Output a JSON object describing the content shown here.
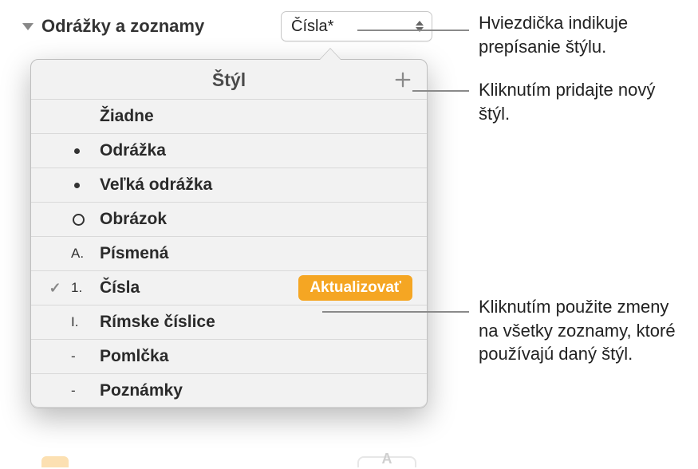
{
  "header": {
    "title": "Odrážky a zoznamy",
    "selected_style": "Čísla*"
  },
  "popover": {
    "title": "Štýl",
    "add_icon": "plus-icon",
    "items": [
      {
        "marker_type": "none",
        "marker": "",
        "label": "Žiadne",
        "selected": false
      },
      {
        "marker_type": "dot",
        "marker": "",
        "label": "Odrážka",
        "selected": false
      },
      {
        "marker_type": "dot",
        "marker": "",
        "label": "Veľká odrážka",
        "selected": false
      },
      {
        "marker_type": "circle",
        "marker": "",
        "label": "Obrázok",
        "selected": false
      },
      {
        "marker_type": "text",
        "marker": "A.",
        "label": "Písmená",
        "selected": false
      },
      {
        "marker_type": "text",
        "marker": "1.",
        "label": "Čísla",
        "selected": true,
        "update_label": "Aktualizovať"
      },
      {
        "marker_type": "text",
        "marker": "I.",
        "label": "Rímske číslice",
        "selected": false
      },
      {
        "marker_type": "text",
        "marker": "-",
        "label": "Pomlčka",
        "selected": false
      },
      {
        "marker_type": "text",
        "marker": "-",
        "label": "Poznámky",
        "selected": false
      }
    ]
  },
  "callouts": {
    "asterisk": "Hviezdička indikuje prepísanie štýlu.",
    "add": "Kliknutím pridajte nový štýl.",
    "update": "Kliknutím použite zmeny na všetky zoznamy, ktoré používajú daný štýl."
  },
  "bottom_icon_text": "A",
  "colors": {
    "accent": "#f5a623"
  }
}
